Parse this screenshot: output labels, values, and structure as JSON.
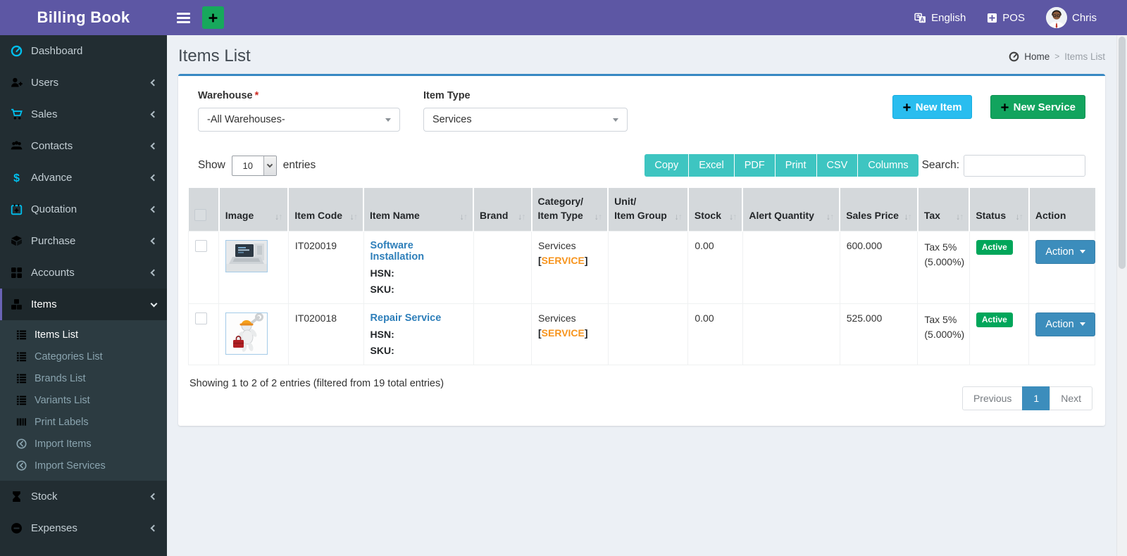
{
  "app_title": "Billing Book",
  "topbar": {
    "language": "English",
    "pos": "POS",
    "username": "Chris"
  },
  "sidebar": {
    "items": [
      {
        "label": "Dashboard"
      },
      {
        "label": "Users"
      },
      {
        "label": "Sales"
      },
      {
        "label": "Contacts"
      },
      {
        "label": "Advance"
      },
      {
        "label": "Quotation"
      },
      {
        "label": "Purchase"
      },
      {
        "label": "Accounts"
      },
      {
        "label": "Items"
      },
      {
        "label": "Stock"
      },
      {
        "label": "Expenses"
      }
    ],
    "items_submenu": [
      {
        "label": "Items List"
      },
      {
        "label": "Categories List"
      },
      {
        "label": "Brands List"
      },
      {
        "label": "Variants List"
      },
      {
        "label": "Print Labels"
      },
      {
        "label": "Import Items"
      },
      {
        "label": "Import Services"
      }
    ]
  },
  "page": {
    "title": "Items List",
    "breadcrumb_home": "Home",
    "breadcrumb_sep": ">",
    "breadcrumb_current": "Items List"
  },
  "filters": {
    "warehouse_label": "Warehouse",
    "required_mark": "*",
    "warehouse_value": "-All Warehouses-",
    "item_type_label": "Item Type",
    "item_type_value": "Services"
  },
  "buttons": {
    "new_item": "New Item",
    "new_service": "New Service"
  },
  "controls": {
    "show": "Show",
    "page_length": "10",
    "entries": "entries",
    "export": [
      "Copy",
      "Excel",
      "PDF",
      "Print",
      "CSV",
      "Columns"
    ],
    "search_label": "Search:"
  },
  "table": {
    "headers": {
      "image": "Image",
      "item_code": "Item Code",
      "item_name": "Item Name",
      "brand": "Brand",
      "category": "Category/\nItem Type",
      "unit": "Unit/\nItem Group",
      "stock": "Stock",
      "alert_quantity": "Alert Quantity",
      "sales_price": "Sales Price",
      "tax": "Tax",
      "status": "Status",
      "action": "Action"
    },
    "row_labels": {
      "hsn": "HSN:",
      "sku": "SKU:",
      "bracket_open": "[",
      "bracket_close": "]"
    },
    "rows": [
      {
        "item_code": "IT020019",
        "item_name": "Software Installation",
        "brand": "",
        "category": "Services",
        "item_type": "SERVICE",
        "unit": "",
        "stock": "0.00",
        "alert_quantity": "",
        "sales_price": "600.000",
        "tax": "Tax 5%\n(5.000%)",
        "status": "Active",
        "action": "Action"
      },
      {
        "item_code": "IT020018",
        "item_name": "Repair Service",
        "brand": "",
        "category": "Services",
        "item_type": "SERVICE",
        "unit": "",
        "stock": "0.00",
        "alert_quantity": "",
        "sales_price": "525.000",
        "tax": "Tax 5%\n(5.000%)",
        "status": "Active",
        "action": "Action"
      }
    ]
  },
  "footer": {
    "summary": "Showing 1 to 2 of 2 entries (filtered from 19 total entries)",
    "previous": "Previous",
    "page": "1",
    "next": "Next"
  },
  "colors": {
    "navbar_purple": "#5d57a4",
    "sidebar_dark": "#222d32",
    "accent_blue": "#3c8dbc",
    "info_cyan": "#29bdef",
    "success_green": "#12a45e",
    "export_teal": "#3ec5c1",
    "type_orange": "#f7941d",
    "badge_green": "#00a65a",
    "icon_cyan": "#00c0ef"
  }
}
